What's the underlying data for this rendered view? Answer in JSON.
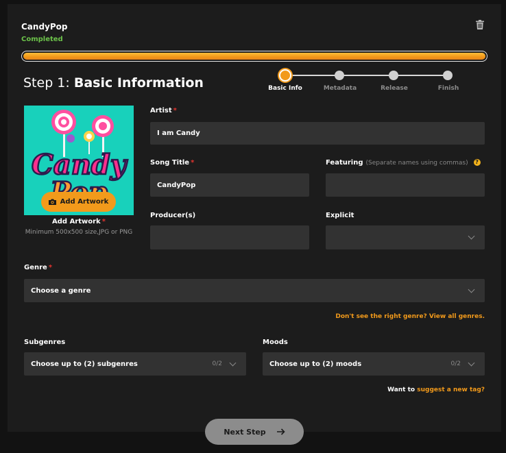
{
  "header": {
    "file_name": "CandyPop",
    "status": "Completed",
    "progress_percent": 100,
    "trash_icon": "trash-icon"
  },
  "step": {
    "prefix": "Step 1:",
    "title": "Basic Information"
  },
  "stepper": [
    {
      "label": "Basic Info",
      "active": true
    },
    {
      "label": "Metadata",
      "active": false
    },
    {
      "label": "Release",
      "active": false
    },
    {
      "label": "Finish",
      "active": false
    }
  ],
  "artwork": {
    "button_label": "Add Artwork",
    "label": "Add Artwork",
    "requirements": "Minimum 500x500 size,JPG or PNG",
    "art_text_line1": "Candy",
    "art_text_line2": "Pop",
    "camera_icon": "camera-icon"
  },
  "fields": {
    "artist": {
      "label": "Artist",
      "required": "*",
      "value": "I am Candy"
    },
    "song_title": {
      "label": "Song Title",
      "required": "*",
      "value": "CandyPop"
    },
    "featuring": {
      "label": "Featuring",
      "hint": "(Separate names using commas)",
      "help": "?",
      "value": ""
    },
    "producers": {
      "label": "Producer(s)",
      "value": ""
    },
    "explicit": {
      "label": "Explicit",
      "value": ""
    },
    "genre": {
      "label": "Genre",
      "required": "*",
      "value": "Choose a genre"
    },
    "subgenres": {
      "label": "Subgenres",
      "value": "Choose up to (2) subgenres",
      "count": "0/2"
    },
    "moods": {
      "label": "Moods",
      "value": "Choose up to (2) moods",
      "count": "0/2"
    }
  },
  "links": {
    "genres_link": "Don't see the right genre? View all genres.",
    "tag_prefix": "Want to",
    "tag_link": "suggest a new tag?"
  },
  "footer": {
    "next_label": "Next Step"
  },
  "colors": {
    "accent": "#f29a1b",
    "success": "#6cc24a",
    "required": "#e3342f",
    "artwork_bg": "#18d1bb"
  }
}
